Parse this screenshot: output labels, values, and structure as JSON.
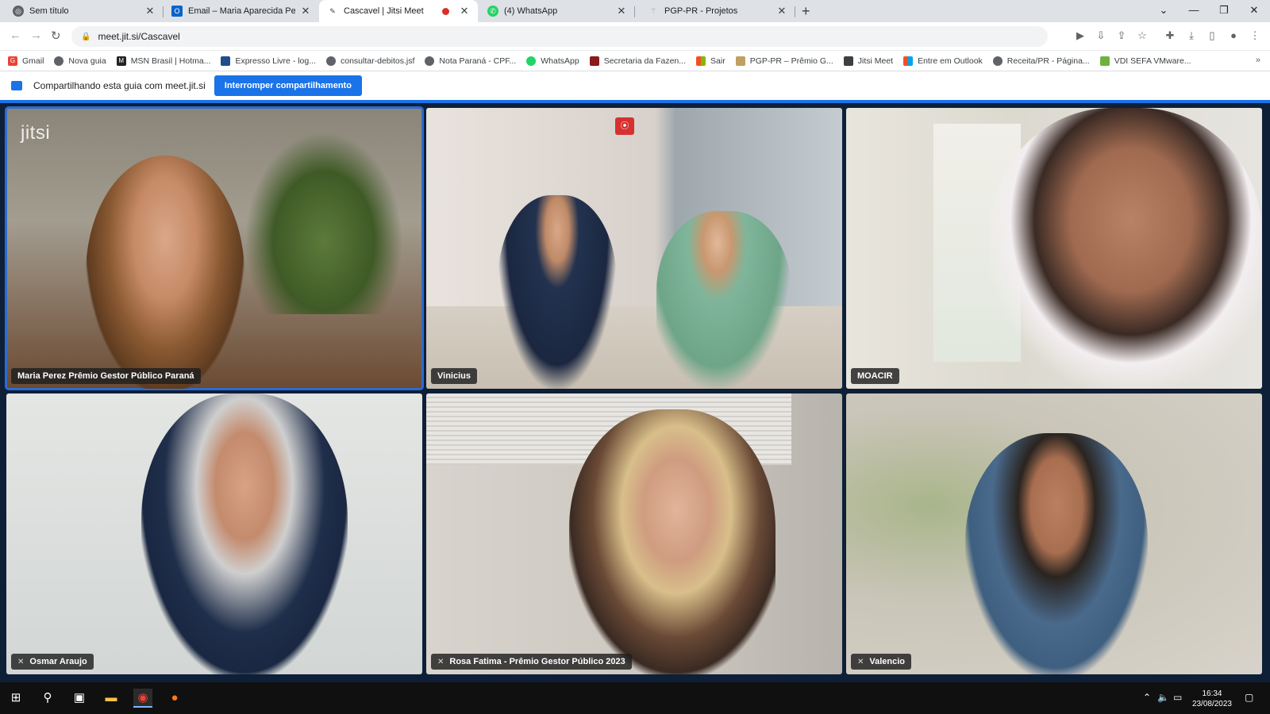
{
  "tabs": [
    {
      "title": "Sem título",
      "icon": "globe-icon",
      "color": "#5f6368"
    },
    {
      "title": "Email – Maria Aparecida Perez N",
      "icon": "outlook-icon",
      "color": "#0a64c8"
    },
    {
      "title": "Cascavel | Jitsi Meet",
      "icon": "jitsi-icon",
      "color": "#3c4043"
    },
    {
      "title": "(4) WhatsApp",
      "icon": "whatsapp-icon",
      "color": "#25d366"
    },
    {
      "title": "PGP-PR - Projetos",
      "icon": "pgp-icon",
      "color": "#c0a060"
    }
  ],
  "address": {
    "url": "meet.jit.si/Cascavel"
  },
  "bookmarks": [
    {
      "label": "Gmail",
      "icon": "google-icon",
      "color": "#ea4335"
    },
    {
      "label": "Nova guia",
      "icon": "globe-icon",
      "color": "#5f6368"
    },
    {
      "label": "MSN Brasil | Hotma...",
      "icon": "msn-icon",
      "color": "#222222"
    },
    {
      "label": "Expresso Livre - log...",
      "icon": "expresso-icon",
      "color": "#1f4e8c"
    },
    {
      "label": "consultar-debitos.jsf",
      "icon": "globe-icon",
      "color": "#5f6368"
    },
    {
      "label": "Nota Paraná - CPF...",
      "icon": "globe-icon",
      "color": "#5f6368"
    },
    {
      "label": "WhatsApp",
      "icon": "whatsapp-icon",
      "color": "#25d366"
    },
    {
      "label": "Secretaria da Fazen...",
      "icon": "shield-icon",
      "color": "#8b1a1a"
    },
    {
      "label": "Sair",
      "icon": "microsoft-icon",
      "color": "#f25022"
    },
    {
      "label": "PGP-PR – Prêmio G...",
      "icon": "pgp-icon",
      "color": "#c0a060"
    },
    {
      "label": "Jitsi Meet",
      "icon": "jitsi-icon",
      "color": "#3c4043"
    },
    {
      "label": "Entre em Outlook",
      "icon": "microsoft-icon",
      "color": "#f25022"
    },
    {
      "label": "Receita/PR - Página...",
      "icon": "globe-icon",
      "color": "#5f6368"
    },
    {
      "label": "VDI SEFA VMware...",
      "icon": "vmware-icon",
      "color": "#6cb33e"
    }
  ],
  "share": {
    "text": "Compartilhando esta guia com meet.jit.si",
    "button": "Interromper compartilhamento"
  },
  "meeting": {
    "logo": "jitsi",
    "participants": [
      {
        "name": "Maria Perez Prêmio Gestor Público Paraná",
        "muted": false
      },
      {
        "name": "Vinicius",
        "muted": false
      },
      {
        "name": "MOACIR",
        "muted": false
      },
      {
        "name": "Osmar Araujo",
        "muted": true
      },
      {
        "name": "Rosa Fatima - Prêmio Gestor Público 2023",
        "muted": true
      },
      {
        "name": "Valencio",
        "muted": true
      }
    ]
  },
  "taskbar": {
    "time": "16:34",
    "date": "23/08/2023"
  },
  "colors": {
    "accent": "#1a73e8",
    "meet_bg": "#0e1f38",
    "record": "#d63030"
  }
}
